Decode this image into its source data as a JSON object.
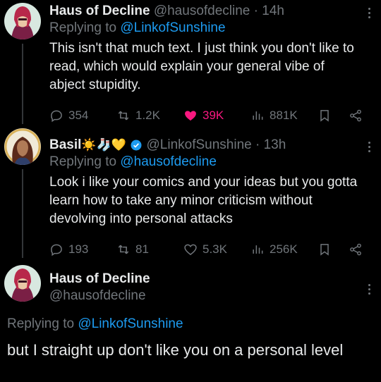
{
  "tweets": [
    {
      "name": "Haus of Decline",
      "handle": "@hausofdecline",
      "separator": "·",
      "time": "14h",
      "replying_prefix": "Replying to",
      "replying_to": "@LinkofSunshine",
      "text": "This isn't that much text. I just think you don't like to read, which would explain your general vibe of abject stupidity.",
      "replies": "354",
      "reposts": "1.2K",
      "likes": "39K",
      "views": "881K"
    },
    {
      "name": "Basil",
      "name_emojis": "☀️🧦💛",
      "handle": "@LinkofSunshine",
      "separator": "·",
      "time": "13h",
      "replying_prefix": "Replying to",
      "replying_to": "@hausofdecline",
      "text": "Look i like your comics and your ideas but you gotta learn how to take any minor criticism without devolving into personal attacks",
      "replies": "193",
      "reposts": "81",
      "likes": "5.3K",
      "views": "256K"
    },
    {
      "name": "Haus of Decline",
      "handle": "@hausofdecline",
      "replying_prefix": "Replying to",
      "replying_to": "@LinkofSunshine",
      "text": "but I straight up don't like you on a personal level"
    }
  ],
  "icons": [
    "reply-icon",
    "repost-icon",
    "like-icon",
    "views-icon",
    "bookmark-icon",
    "share-icon",
    "more-icon",
    "verified-icon"
  ],
  "colors": {
    "background": "#000000",
    "text": "#e7e9ea",
    "secondary": "#71767b",
    "link": "#1d9bf0",
    "like_active": "#f91880",
    "verified": "#1d9bf0"
  }
}
